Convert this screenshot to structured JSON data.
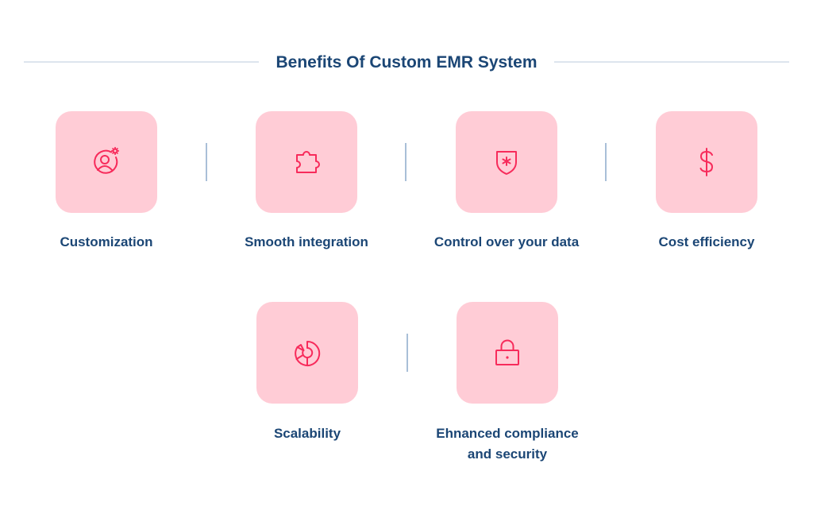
{
  "title": "Benefits Of Custom EMR System",
  "colors": {
    "accent": "#f72b5b",
    "card_bg": "#ffccd6",
    "text": "#1b4675",
    "divider": "#a9bfd8"
  },
  "benefits": [
    {
      "label": "Customization",
      "icon": "user-gear-icon"
    },
    {
      "label": "Smooth integration",
      "icon": "puzzle-icon"
    },
    {
      "label": "Control over your data",
      "icon": "shield-star-icon"
    },
    {
      "label": "Cost efficiency",
      "icon": "dollar-icon"
    },
    {
      "label": "Scalability",
      "icon": "pie-chart-icon"
    },
    {
      "label_line1": "Ehnanced compliance",
      "label_line2": "and security",
      "icon": "lock-icon"
    }
  ]
}
